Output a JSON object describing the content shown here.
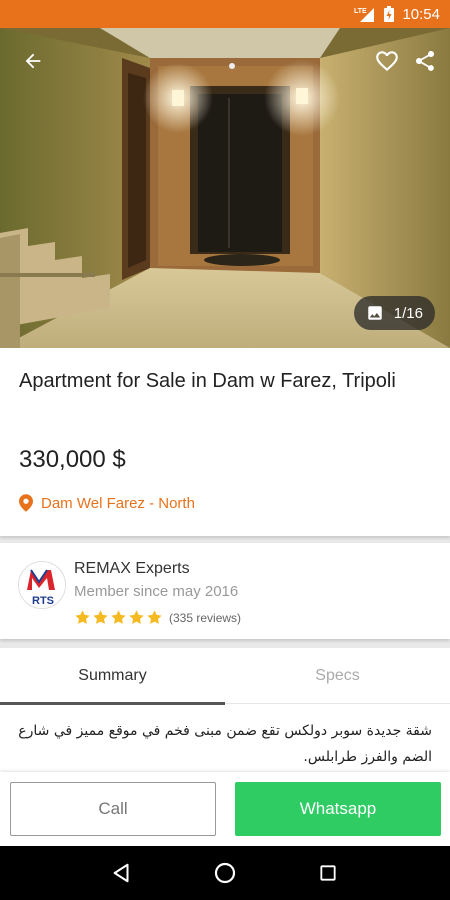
{
  "status_bar": {
    "time": "10:54",
    "network": "LTE"
  },
  "photo": {
    "counter": "1/16"
  },
  "listing": {
    "title": "Apartment for Sale in Dam w Farez, Tripoli",
    "price": "330,000 $",
    "location": "Dam Wel Farez - North"
  },
  "agent": {
    "name": "REMAX Experts",
    "member_since": "Member since may 2016",
    "rating_stars": 5,
    "reviews": "(335 reviews)",
    "logo_text": "RTS"
  },
  "tabs": [
    {
      "label": "Summary",
      "active": true
    },
    {
      "label": "Specs",
      "active": false
    }
  ],
  "description": "شقة جديدة سوبر دولكس تقع ضمن مبنى فخم في موقع مميز في شارع الضم والفرز طرابلس.",
  "actions": {
    "call_label": "Call",
    "whatsapp_label": "Whatsapp"
  },
  "colors": {
    "accent": "#e8721c",
    "whatsapp": "#2ecc63",
    "star": "#f5b921"
  },
  "icons": [
    "back-arrow-icon",
    "heart-icon",
    "share-icon",
    "image-icon",
    "location-pin-icon",
    "star-icon",
    "nav-back-icon",
    "nav-home-icon",
    "nav-recents-icon"
  ]
}
